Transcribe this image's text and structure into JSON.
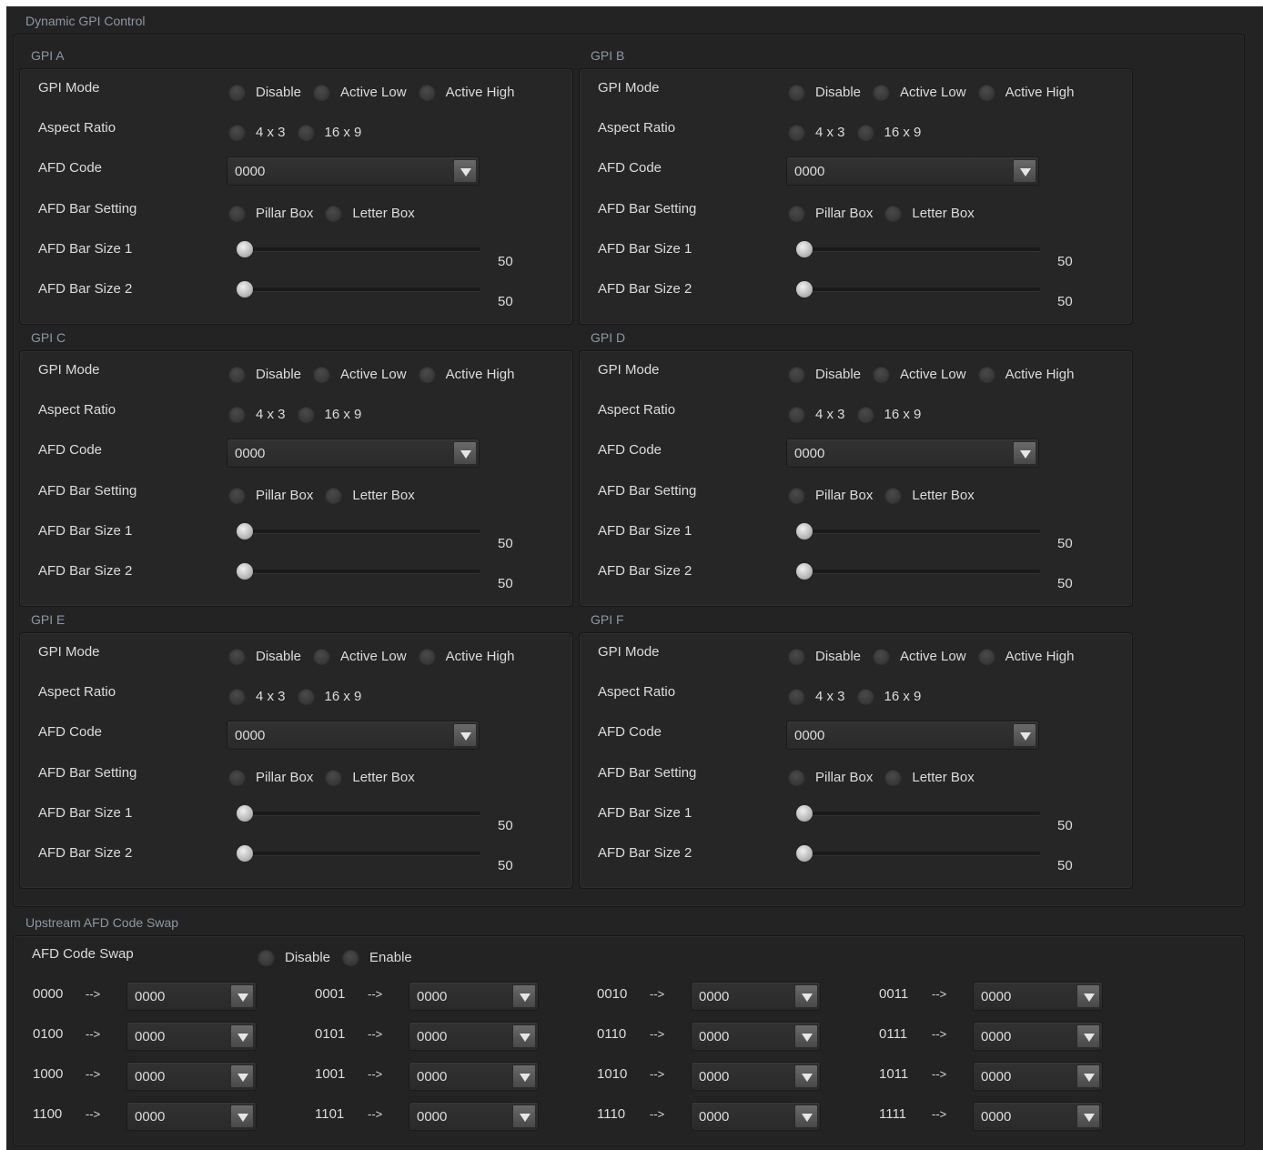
{
  "panel": {
    "title": "Dynamic GPI Control"
  },
  "labels": {
    "gpi_mode": "GPI Mode",
    "aspect_ratio": "Aspect Ratio",
    "afd_code": "AFD Code",
    "afd_bar_setting": "AFD Bar Setting",
    "afd_bar_size_1": "AFD Bar Size 1",
    "afd_bar_size_2": "AFD Bar Size 2"
  },
  "options": {
    "gpi_mode": [
      "Disable",
      "Active Low",
      "Active High"
    ],
    "aspect_ratio": [
      "4 x 3",
      "16 x 9"
    ],
    "afd_bar_setting": [
      "Pillar Box",
      "Letter Box"
    ]
  },
  "gpis": [
    {
      "title": "GPI A",
      "afd_code": "0000",
      "bar_size_1": "50",
      "bar_size_2": "50",
      "bar_size_1_fraction": 0,
      "bar_size_2_fraction": 0
    },
    {
      "title": "GPI B",
      "afd_code": "0000",
      "bar_size_1": "50",
      "bar_size_2": "50",
      "bar_size_1_fraction": 0,
      "bar_size_2_fraction": 0
    },
    {
      "title": "GPI C",
      "afd_code": "0000",
      "bar_size_1": "50",
      "bar_size_2": "50",
      "bar_size_1_fraction": 0,
      "bar_size_2_fraction": 0
    },
    {
      "title": "GPI D",
      "afd_code": "0000",
      "bar_size_1": "50",
      "bar_size_2": "50",
      "bar_size_1_fraction": 0,
      "bar_size_2_fraction": 0
    },
    {
      "title": "GPI E",
      "afd_code": "0000",
      "bar_size_1": "50",
      "bar_size_2": "50",
      "bar_size_1_fraction": 0,
      "bar_size_2_fraction": 0
    },
    {
      "title": "GPI F",
      "afd_code": "0000",
      "bar_size_1": "50",
      "bar_size_2": "50",
      "bar_size_1_fraction": 0,
      "bar_size_2_fraction": 0
    }
  ],
  "swap": {
    "title": "Upstream AFD Code Swap",
    "label": "AFD Code Swap",
    "options": [
      "Disable",
      "Enable"
    ],
    "arrow": "-->",
    "rows": [
      {
        "code": "0000",
        "value": "0000"
      },
      {
        "code": "0001",
        "value": "0000"
      },
      {
        "code": "0010",
        "value": "0000"
      },
      {
        "code": "0011",
        "value": "0000"
      },
      {
        "code": "0100",
        "value": "0000"
      },
      {
        "code": "0101",
        "value": "0000"
      },
      {
        "code": "0110",
        "value": "0000"
      },
      {
        "code": "0111",
        "value": "0000"
      },
      {
        "code": "1000",
        "value": "0000"
      },
      {
        "code": "1001",
        "value": "0000"
      },
      {
        "code": "1010",
        "value": "0000"
      },
      {
        "code": "1011",
        "value": "0000"
      },
      {
        "code": "1100",
        "value": "0000"
      },
      {
        "code": "1101",
        "value": "0000"
      },
      {
        "code": "1110",
        "value": "0000"
      },
      {
        "code": "1111",
        "value": "0000"
      }
    ]
  },
  "icons": {
    "dropdown": "chevron-down-icon",
    "radio": "radio-button"
  },
  "colors": {
    "background": "#232323",
    "section_title": "#8e97a3",
    "text": "#dcdcdc"
  }
}
